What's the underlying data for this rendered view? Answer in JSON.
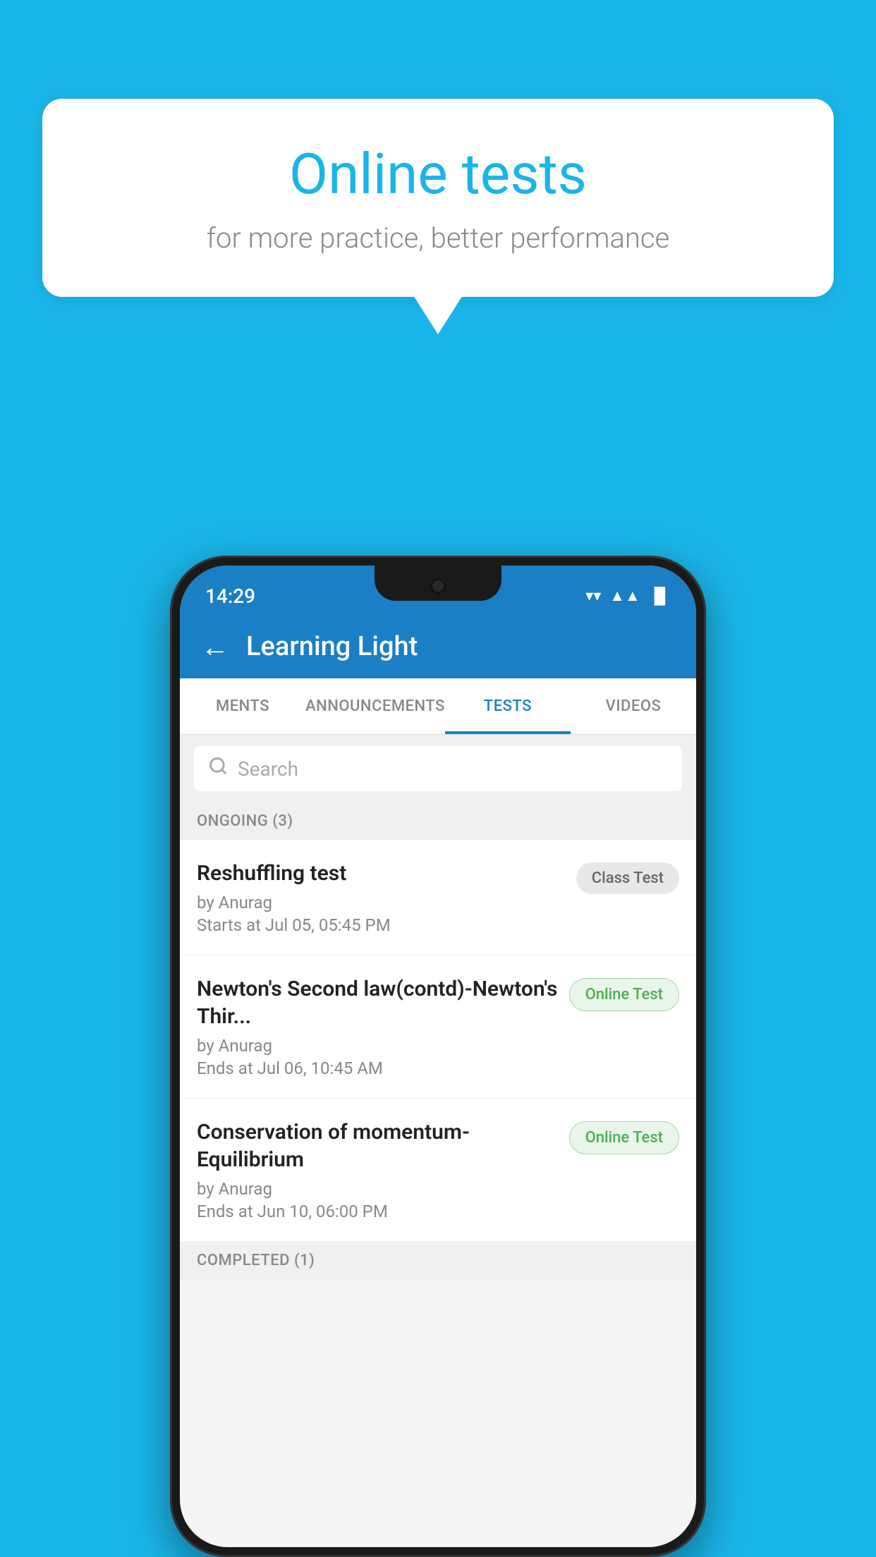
{
  "background": {
    "color": "#1ab5e8"
  },
  "speech_bubble": {
    "title": "Online tests",
    "subtitle": "for more practice, better performance"
  },
  "status_bar": {
    "time": "14:29",
    "wifi_icon": "▼",
    "signal_icon": "▲",
    "battery_icon": "▐"
  },
  "app_header": {
    "back_icon": "←",
    "title": "Learning Light"
  },
  "tabs": [
    {
      "label": "MENTS",
      "active": false
    },
    {
      "label": "ANNOUNCEMENTS",
      "active": false
    },
    {
      "label": "TESTS",
      "active": true
    },
    {
      "label": "VIDEOS",
      "active": false
    }
  ],
  "search": {
    "placeholder": "Search",
    "icon": "🔍"
  },
  "ongoing_section": {
    "label": "ONGOING (3)"
  },
  "tests": [
    {
      "name": "Reshuffling test",
      "by": "by Anurag",
      "time": "Starts at  Jul 05, 05:45 PM",
      "badge": "Class Test",
      "badge_type": "class"
    },
    {
      "name": "Newton's Second law(contd)-Newton's Thir...",
      "by": "by Anurag",
      "time": "Ends at  Jul 06, 10:45 AM",
      "badge": "Online Test",
      "badge_type": "online"
    },
    {
      "name": "Conservation of momentum-Equilibrium",
      "by": "by Anurag",
      "time": "Ends at  Jun 10, 06:00 PM",
      "badge": "Online Test",
      "badge_type": "online"
    }
  ],
  "completed_section": {
    "label": "COMPLETED (1)"
  }
}
